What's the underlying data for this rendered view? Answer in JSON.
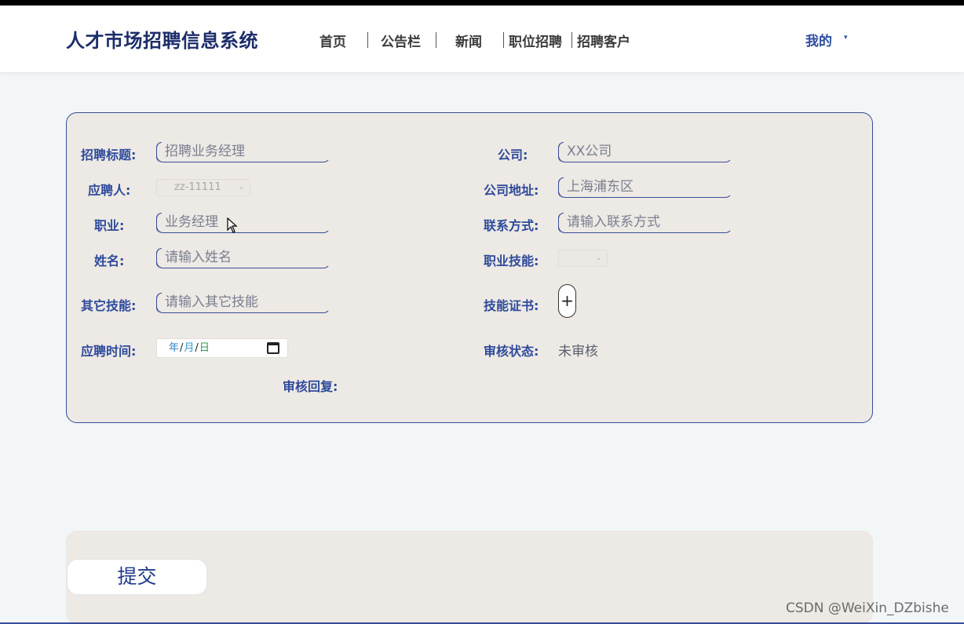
{
  "site_title": "人才市场招聘信息系统",
  "nav": {
    "items": [
      "首页",
      "公告栏",
      "新闻",
      "职位招聘",
      "招聘客户"
    ],
    "me_label": "我的",
    "me_caret": "▾"
  },
  "form": {
    "title_label": "招聘标题:",
    "title_value": "招聘业务经理",
    "company_label": "公司:",
    "company_value": "XX公司",
    "applicant_label": "应聘人:",
    "applicant_value": "zz-11111",
    "address_label": "公司地址:",
    "address_value": "上海浦东区",
    "occupation_label": "职业:",
    "occupation_value": "业务经理",
    "contact_label": "联系方式:",
    "contact_placeholder": "请输入联系方式",
    "name_label": "姓名:",
    "name_placeholder": "请输入姓名",
    "skill_label": "职业技能:",
    "skill_value": "",
    "other_skill_label": "其它技能:",
    "other_skill_placeholder": "请输入其它技能",
    "certificate_label": "技能证书:",
    "certificate_button": "+",
    "time_label": "应聘时间:",
    "date_year": "年",
    "date_month": "月",
    "date_day": "日",
    "status_label": "审核状态:",
    "status_value": "未审核",
    "reply_label": "审核回复:"
  },
  "submit_label": "提交",
  "watermark": "CSDN @WeiXin_DZbishe"
}
